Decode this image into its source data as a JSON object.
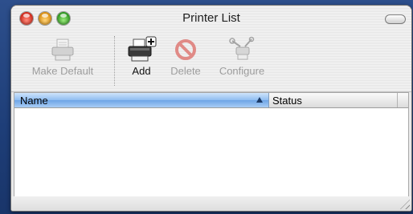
{
  "window": {
    "title": "Printer List"
  },
  "toolbar": {
    "make_default": {
      "label": "Make Default",
      "icon": "printer-icon",
      "enabled": false
    },
    "add": {
      "label": "Add",
      "icon": "add-printer-icon",
      "enabled": true
    },
    "delete": {
      "label": "Delete",
      "icon": "delete-icon",
      "enabled": false
    },
    "configure": {
      "label": "Configure",
      "icon": "configure-tools-icon",
      "enabled": false
    }
  },
  "table": {
    "columns": [
      {
        "label": "Name",
        "sorted": "ascending"
      },
      {
        "label": "Status"
      }
    ],
    "rows": []
  },
  "colors": {
    "header_highlight": "#8fbdf0",
    "close": "#d42a1c",
    "minimize": "#dc8f0f",
    "zoom": "#2f9a22"
  }
}
